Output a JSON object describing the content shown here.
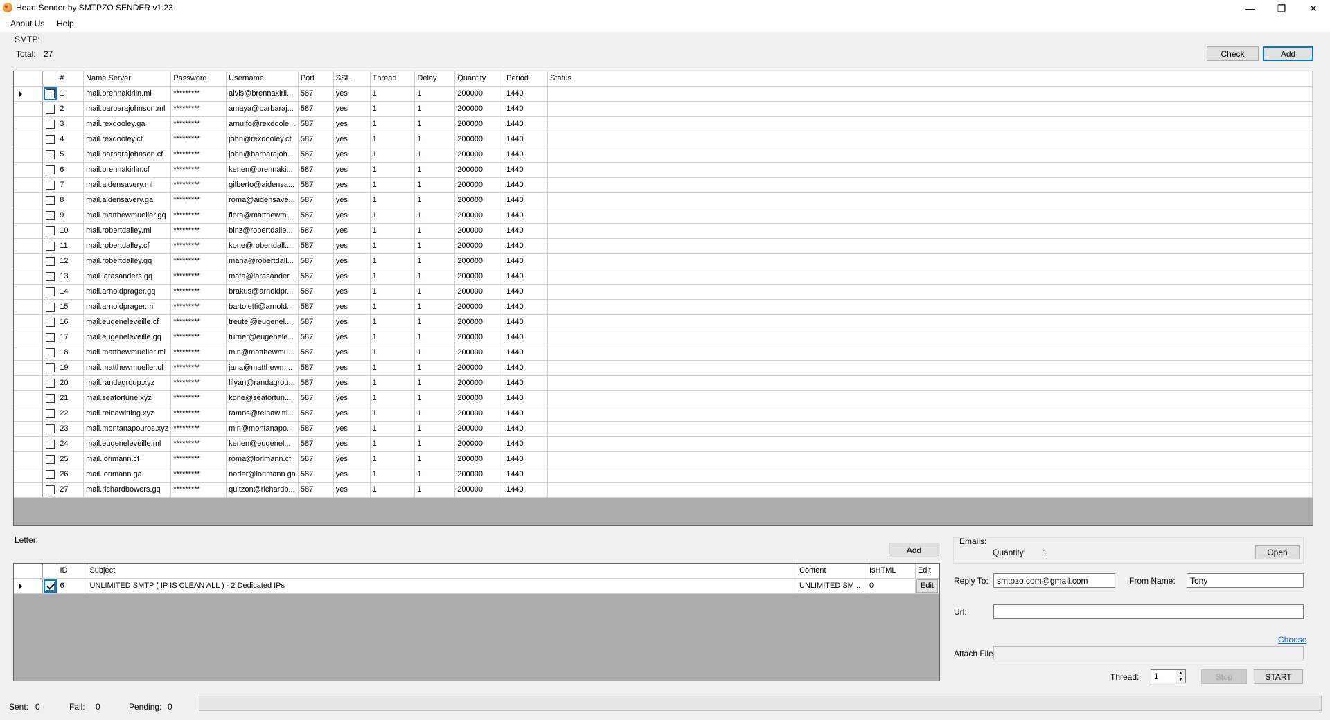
{
  "window": {
    "title": "Heart Sender by SMTPZO SENDER v1.23",
    "controls": {
      "minimize": "—",
      "maximize": "❐",
      "close": "✕"
    }
  },
  "menu": {
    "items": [
      "About Us",
      "Help"
    ]
  },
  "smtp": {
    "group_label": "SMTP:",
    "total_label": "Total:",
    "total_value": "27",
    "check_button": "Check",
    "add_button": "Add",
    "columns": [
      "#",
      "Name Server",
      "Password",
      "Username",
      "Port",
      "SSL",
      "Thread",
      "Delay",
      "Quantity",
      "Period",
      "Status"
    ],
    "rows": [
      [
        "1",
        "mail.brennakirlin.ml",
        "*********",
        "alvis@brennakirli...",
        "587",
        "yes",
        "1",
        "1",
        "200000",
        "1440",
        ""
      ],
      [
        "2",
        "mail.barbarajohnson.ml",
        "*********",
        "amaya@barbaraj...",
        "587",
        "yes",
        "1",
        "1",
        "200000",
        "1440",
        ""
      ],
      [
        "3",
        "mail.rexdooley.ga",
        "*********",
        "arnulfo@rexdoole...",
        "587",
        "yes",
        "1",
        "1",
        "200000",
        "1440",
        ""
      ],
      [
        "4",
        "mail.rexdooley.cf",
        "*********",
        "john@rexdooley.cf",
        "587",
        "yes",
        "1",
        "1",
        "200000",
        "1440",
        ""
      ],
      [
        "5",
        "mail.barbarajohnson.cf",
        "*********",
        "john@barbarajoh...",
        "587",
        "yes",
        "1",
        "1",
        "200000",
        "1440",
        ""
      ],
      [
        "6",
        "mail.brennakirlin.cf",
        "*********",
        "kenen@brennaki...",
        "587",
        "yes",
        "1",
        "1",
        "200000",
        "1440",
        ""
      ],
      [
        "7",
        "mail.aidensavery.ml",
        "*********",
        "gilberto@aidensa...",
        "587",
        "yes",
        "1",
        "1",
        "200000",
        "1440",
        ""
      ],
      [
        "8",
        "mail.aidensavery.ga",
        "*********",
        "roma@aidensave...",
        "587",
        "yes",
        "1",
        "1",
        "200000",
        "1440",
        ""
      ],
      [
        "9",
        "mail.matthewmueller.gq",
        "*********",
        "fiora@matthewm...",
        "587",
        "yes",
        "1",
        "1",
        "200000",
        "1440",
        ""
      ],
      [
        "10",
        "mail.robertdalley.ml",
        "*********",
        "binz@robertdalle...",
        "587",
        "yes",
        "1",
        "1",
        "200000",
        "1440",
        ""
      ],
      [
        "11",
        "mail.robertdalley.cf",
        "*********",
        "kone@robertdall...",
        "587",
        "yes",
        "1",
        "1",
        "200000",
        "1440",
        ""
      ],
      [
        "12",
        "mail.robertdalley.gq",
        "*********",
        "mana@robertdall...",
        "587",
        "yes",
        "1",
        "1",
        "200000",
        "1440",
        ""
      ],
      [
        "13",
        "mail.larasanders.gq",
        "*********",
        "mata@larasander...",
        "587",
        "yes",
        "1",
        "1",
        "200000",
        "1440",
        ""
      ],
      [
        "14",
        "mail.arnoldprager.gq",
        "*********",
        "brakus@arnoldpr...",
        "587",
        "yes",
        "1",
        "1",
        "200000",
        "1440",
        ""
      ],
      [
        "15",
        "mail.arnoldprager.ml",
        "*********",
        "bartoletti@arnold...",
        "587",
        "yes",
        "1",
        "1",
        "200000",
        "1440",
        ""
      ],
      [
        "16",
        "mail.eugeneleveille.cf",
        "*********",
        "treutel@eugenel...",
        "587",
        "yes",
        "1",
        "1",
        "200000",
        "1440",
        ""
      ],
      [
        "17",
        "mail.eugeneleveille.gq",
        "*********",
        "turner@eugenele...",
        "587",
        "yes",
        "1",
        "1",
        "200000",
        "1440",
        ""
      ],
      [
        "18",
        "mail.matthewmueller.ml",
        "*********",
        "min@matthewmu...",
        "587",
        "yes",
        "1",
        "1",
        "200000",
        "1440",
        ""
      ],
      [
        "19",
        "mail.matthewmueller.cf",
        "*********",
        "jana@matthewm...",
        "587",
        "yes",
        "1",
        "1",
        "200000",
        "1440",
        ""
      ],
      [
        "20",
        "mail.randagroup.xyz",
        "*********",
        "lilyan@randagrou...",
        "587",
        "yes",
        "1",
        "1",
        "200000",
        "1440",
        ""
      ],
      [
        "21",
        "mail.seafortune.xyz",
        "*********",
        "kone@seafortun...",
        "587",
        "yes",
        "1",
        "1",
        "200000",
        "1440",
        ""
      ],
      [
        "22",
        "mail.reinawitting.xyz",
        "*********",
        "ramos@reinawitti...",
        "587",
        "yes",
        "1",
        "1",
        "200000",
        "1440",
        ""
      ],
      [
        "23",
        "mail.montanapouros.xyz",
        "*********",
        "min@montanapo...",
        "587",
        "yes",
        "1",
        "1",
        "200000",
        "1440",
        ""
      ],
      [
        "24",
        "mail.eugeneleveille.ml",
        "*********",
        "kenen@eugenel...",
        "587",
        "yes",
        "1",
        "1",
        "200000",
        "1440",
        ""
      ],
      [
        "25",
        "mail.lorimann.cf",
        "*********",
        "roma@lorimann.cf",
        "587",
        "yes",
        "1",
        "1",
        "200000",
        "1440",
        ""
      ],
      [
        "26",
        "mail.lorimann.ga",
        "*********",
        "nader@lorimann.ga",
        "587",
        "yes",
        "1",
        "1",
        "200000",
        "1440",
        ""
      ],
      [
        "27",
        "mail.richardbowers.gq",
        "*********",
        "quitzon@richardb...",
        "587",
        "yes",
        "1",
        "1",
        "200000",
        "1440",
        ""
      ]
    ]
  },
  "letter": {
    "group_label": "Letter:",
    "add_button": "Add",
    "columns": [
      "ID",
      "Subject",
      "Content",
      "IsHTML",
      "Edit"
    ],
    "rows": [
      {
        "id": "6",
        "subject": "UNLIMITED SMTP ( IP IS CLEAN ALL ) - 2 Dedicated IPs",
        "content": "UNLIMITED SM...",
        "ishtml": "0",
        "edit": "Edit",
        "checked": true
      }
    ]
  },
  "emails": {
    "group_label": "Emails:",
    "quantity_label": "Quantity:",
    "quantity_value": "1",
    "open_button": "Open"
  },
  "form": {
    "reply_to_label": "Reply To:",
    "reply_to_value": "smtpzo.com@gmail.com",
    "from_name_label": "From Name:",
    "from_name_value": "Tony",
    "url_label": "Url:",
    "url_value": "",
    "choose_link": "Choose",
    "attach_label": "Attach File:",
    "attach_value": "",
    "thread_label": "Thread:",
    "thread_value": "1",
    "stop_button": "Stop",
    "start_button": "START"
  },
  "status": {
    "sent_label": "Sent:",
    "sent_value": "0",
    "fail_label": "Fail:",
    "fail_value": "0",
    "pending_label": "Pending:",
    "pending_value": "0",
    "progress": 0
  },
  "icons": {
    "app": "heart-icon",
    "row_pointer": "row-pointer-icon"
  }
}
